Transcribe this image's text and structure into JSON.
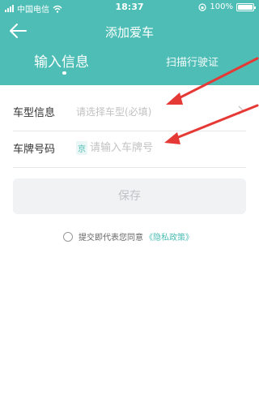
{
  "status_bar": {
    "carrier": "中国电信",
    "time": "18:37",
    "battery": "100%",
    "battery_level": 1.0
  },
  "header": {
    "title": "添加爱车",
    "colors": {
      "accent": "#4dbdb5"
    }
  },
  "tabs": [
    {
      "label": "输入信息",
      "active": true
    },
    {
      "label": "扫描行驶证",
      "active": false
    }
  ],
  "form": {
    "car_type": {
      "label": "车型信息",
      "placeholder": "请选择车型(必填)"
    },
    "plate": {
      "label": "车牌号码",
      "prefix": "京",
      "placeholder": "请输入车牌号"
    }
  },
  "save_label": "保存",
  "agreement": {
    "text": "提交即代表您同意",
    "link": "《隐私政策》"
  },
  "icons": {
    "back": "arrow-left-icon",
    "wifi": "wifi-icon",
    "battery": "battery-icon",
    "chevron": "chevron-right-icon"
  }
}
